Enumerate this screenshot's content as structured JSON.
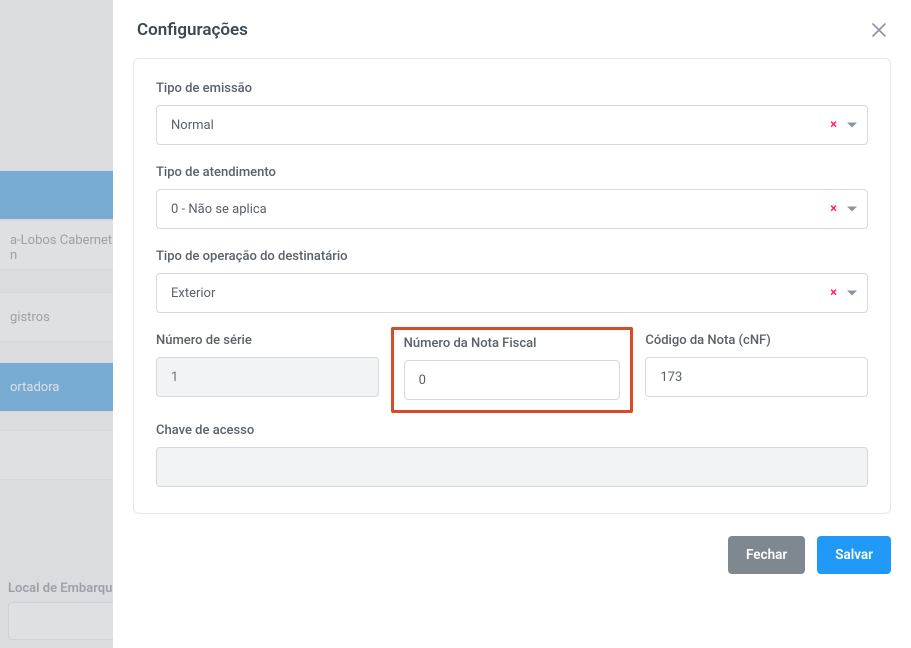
{
  "background": {
    "sidebar": {
      "item_active_top": "",
      "item_product": "a-Lobos Cabernet",
      "item_product_line2": "n",
      "item_registros": "gistros",
      "item_transportadora": "ortadora"
    },
    "label_local_embarque": "Local de Embarque"
  },
  "modal": {
    "title": "Configurações",
    "fields": {
      "tipo_emissao": {
        "label": "Tipo de emissão",
        "value": "Normal"
      },
      "tipo_atendimento": {
        "label": "Tipo de atendimento",
        "value": "0 - Não se aplica"
      },
      "tipo_operacao": {
        "label": "Tipo de operação do destinatário",
        "value": "Exterior"
      },
      "numero_serie": {
        "label": "Número de série",
        "value": "1"
      },
      "numero_nota": {
        "label": "Número da Nota Fiscal",
        "value": "0"
      },
      "codigo_nota": {
        "label": "Código da Nota (cNF)",
        "value": "173"
      },
      "chave_acesso": {
        "label": "Chave de acesso",
        "value": ""
      }
    },
    "buttons": {
      "close": "Fechar",
      "save": "Salvar"
    }
  }
}
